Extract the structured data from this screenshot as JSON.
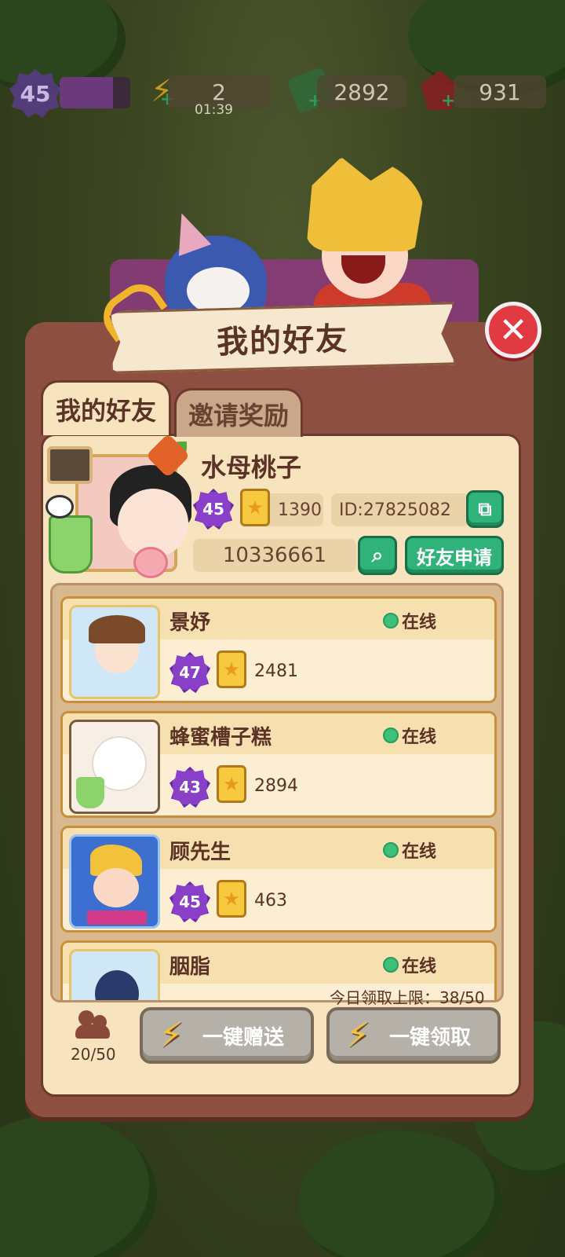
{
  "hud": {
    "level": "45",
    "xp_fraction": 0.75,
    "energy": "2",
    "energy_timer": "01:39",
    "cash": "2892",
    "gems": "931"
  },
  "panel": {
    "title": "我的好友",
    "tabs": [
      {
        "label": "我的好友",
        "active": true
      },
      {
        "label": "邀请奖励",
        "active": false
      }
    ],
    "close_icon": "close-icon"
  },
  "profile": {
    "name": "水母桃子",
    "level": "45",
    "stars": "1390",
    "id_text": "ID:27825082",
    "search_value": "10336661",
    "friend_request_label": "好友申请"
  },
  "friends": [
    {
      "name": "景妤",
      "status": "在线",
      "level": "47",
      "score": "2481"
    },
    {
      "name": "蜂蜜槽子糕",
      "status": "在线",
      "level": "43",
      "score": "2894"
    },
    {
      "name": "顾先生",
      "status": "在线",
      "level": "45",
      "score": "463"
    },
    {
      "name": "胭脂",
      "status": "在线",
      "level": "",
      "score": ""
    }
  ],
  "footer": {
    "limit_text": "今日领取上限：38/50",
    "friend_count": "20/50",
    "send_all_label": "一键赠送",
    "claim_all_label": "一键领取"
  },
  "colors": {
    "panel_brown": "#8d4f40",
    "panel_cream": "#f7e4bf",
    "accent_green": "#2fb37a",
    "close_red": "#e23a42",
    "level_purple": "#8a3fc8",
    "online_green": "#3cc07a"
  }
}
